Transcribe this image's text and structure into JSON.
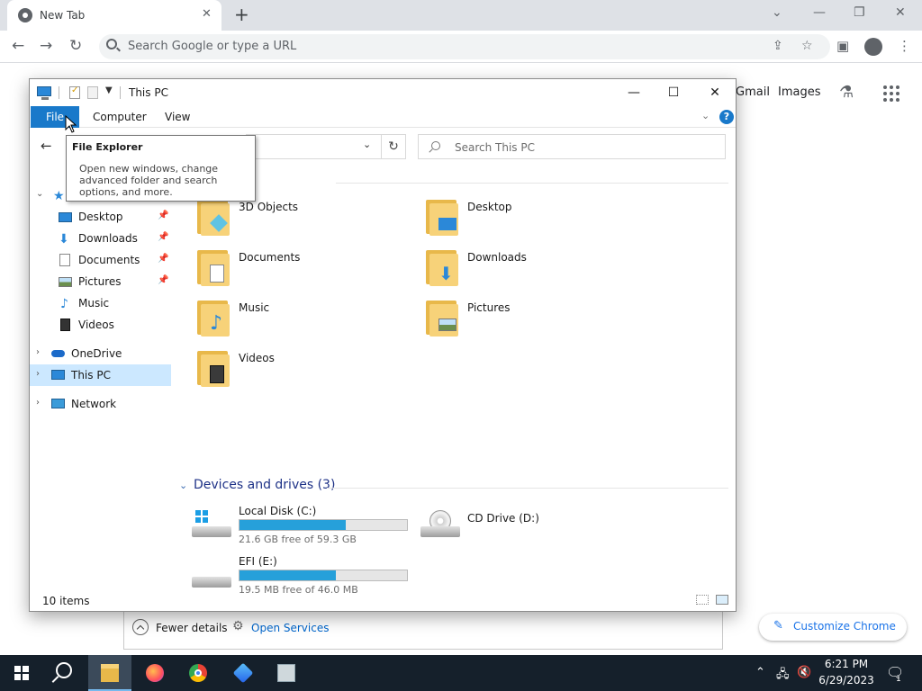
{
  "chrome": {
    "tab_title": "New Tab",
    "omnibox_placeholder": "Search Google or type a URL",
    "ntp_links": {
      "gmail": "Gmail",
      "images": "Images"
    },
    "customize_label": "Customize Chrome"
  },
  "explorer": {
    "title": "This PC",
    "ribbon_tabs": {
      "file": "File",
      "computer": "Computer",
      "view": "View"
    },
    "search_placeholder": "Search This PC",
    "help_label": "?",
    "tooltip": {
      "title": "File Explorer",
      "body": "Open new windows, change advanced folder and search options, and more."
    },
    "nav": {
      "quick_access": [
        {
          "label": "Desktop"
        },
        {
          "label": "Downloads"
        },
        {
          "label": "Documents"
        },
        {
          "label": "Pictures"
        },
        {
          "label": "Music"
        },
        {
          "label": "Videos"
        }
      ],
      "onedrive": "OneDrive",
      "this_pc": "This PC",
      "network": "Network"
    },
    "folders": [
      {
        "label": "3D Objects",
        "icon": "cube-icon"
      },
      {
        "label": "Desktop",
        "icon": "desktop-icon"
      },
      {
        "label": "Documents",
        "icon": "document-icon"
      },
      {
        "label": "Downloads",
        "icon": "download-arrow-icon"
      },
      {
        "label": "Music",
        "icon": "music-note-icon"
      },
      {
        "label": "Pictures",
        "icon": "picture-icon"
      },
      {
        "label": "Videos",
        "icon": "film-icon"
      }
    ],
    "devices_header": "Devices and drives (3)",
    "drives": [
      {
        "name": "Local Disk (C:)",
        "free": "21.6 GB free of 59.3 GB",
        "used_fraction": 0.636
      },
      {
        "name": "CD Drive (D:)"
      },
      {
        "name": "EFI (E:)",
        "free": "19.5 MB free of 46.0 MB",
        "used_fraction": 0.576
      }
    ],
    "status": "10 items"
  },
  "task_manager": {
    "fewer_details": "Fewer details",
    "open_services": "Open Services"
  },
  "taskbar": {
    "time": "6:21 PM",
    "date": "6/29/2023",
    "notification_count": "1"
  },
  "colors": {
    "accent": "#1979ca",
    "selection": "#cce8ff",
    "drive_fill": "#26a0da",
    "taskbar": "#15202b"
  }
}
